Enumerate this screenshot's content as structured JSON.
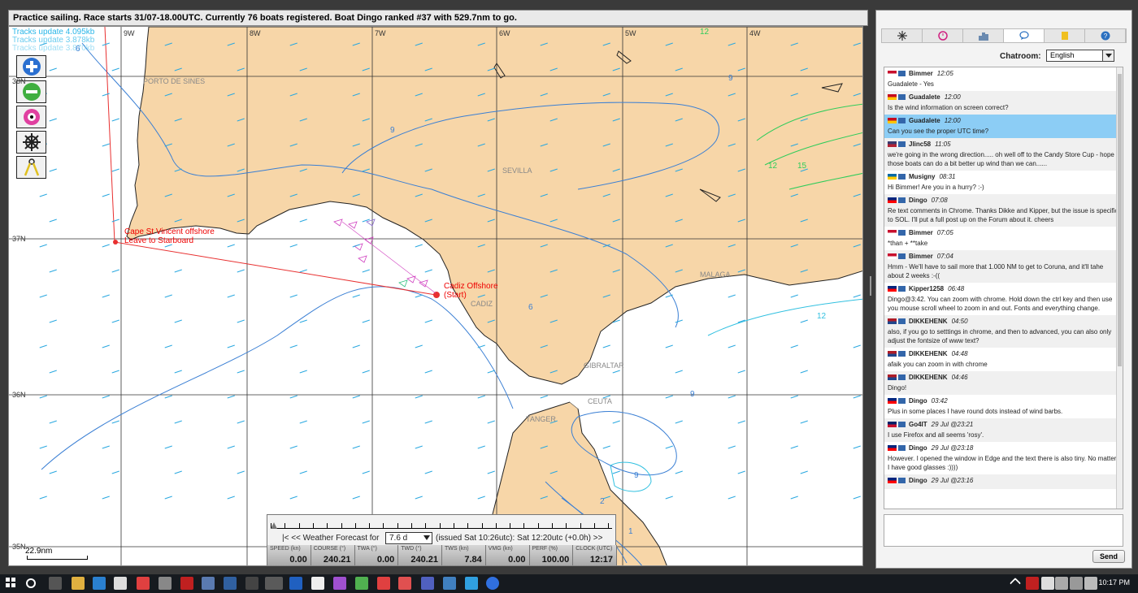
{
  "status_bar": {
    "text": "Practice sailing. Race starts 31/07-18.00UTC. Currently 76 boats registered. Boat Dingo ranked #37 with 529.7nm to go."
  },
  "map": {
    "track_updates": [
      "Tracks update 4.095kb",
      "Tracks update 3.878kb",
      "Tracks update 3.870kb"
    ],
    "lon_labels": [
      "9W",
      "8W",
      "7W",
      "6W",
      "5W",
      "4W"
    ],
    "lat_labels": [
      "38N",
      "37N",
      "36N",
      "35N"
    ],
    "cities": [
      "PORTO DE SINES",
      "SEVILLA",
      "MALAGA",
      "GIBRALTAR",
      "CEUTA",
      "TANGER",
      "CADIZ"
    ],
    "markers": {
      "cape": [
        "Cape St Vincent offshore",
        "Leave to Starboard"
      ],
      "start": [
        "Cadiz Offshore",
        "(Start)"
      ]
    },
    "contour_labels": [
      "6",
      "12",
      "9",
      "9",
      "12",
      "15",
      "6",
      "12",
      "9",
      "9",
      "2",
      "1"
    ],
    "scale_label": "22.9nm",
    "tools": [
      "zoom-in",
      "zoom-out",
      "center-boat",
      "helm",
      "waypoint"
    ]
  },
  "forecast": {
    "prefix": "|<  <<  Weather Forecast for",
    "selected": "7.6 d",
    "issued": "(issued Sat 10:26utc): Sat 12:20utc  (+0.0h)  >>",
    "metrics": [
      {
        "label": "SPEED (kn)",
        "value": "0.00"
      },
      {
        "label": "COURSE (°)",
        "value": "240.21"
      },
      {
        "label": "TWA (°)",
        "value": "0.00"
      },
      {
        "label": "TWD (°)",
        "value": "240.21"
      },
      {
        "label": "TWS (kn)",
        "value": "7.84"
      },
      {
        "label": "VMG (kn)",
        "value": "0.00"
      },
      {
        "label": "PERF (%)",
        "value": "100.00"
      },
      {
        "label": "CLOCK (UTC)",
        "value": "12:17"
      }
    ]
  },
  "sidebar": {
    "tabs": [
      "compass",
      "clock",
      "ranking",
      "chat",
      "notes",
      "help"
    ],
    "active_tab": "chat",
    "chatroom_label": "Chatroom:",
    "chatroom_value": "English",
    "send_label": "Send",
    "messages": [
      {
        "flag": "dk",
        "user": "Bimmer",
        "time": "12:05",
        "text": "Guadalete - Yes"
      },
      {
        "flag": "es",
        "user": "Guadalete",
        "time": "12:00",
        "text": "Is the wind information on screen correct?"
      },
      {
        "flag": "es",
        "user": "Guadalete",
        "time": "12:00",
        "text": "Can you see the proper UTC time?"
      },
      {
        "flag": "us",
        "user": "Jlinc58",
        "time": "11:05",
        "text": "we're going in the wrong direction..... oh well off to the Candy Store Cup - hope those boats can do a bit better up wind than we can......"
      },
      {
        "flag": "se",
        "user": "Musigny",
        "time": "08:31",
        "text": "Hi Bimmer! Are you in a hurry? :-)"
      },
      {
        "flag": "au",
        "user": "Dingo",
        "time": "07:08",
        "text": "Re text comments in Chrome.  Thanks Dikke and Kipper, but the issue is specific to SOL. I'll put a full post up on the Forum about it. cheers"
      },
      {
        "flag": "dk",
        "user": "Bimmer",
        "time": "07:05",
        "text": "*than + **take"
      },
      {
        "flag": "dk",
        "user": "Bimmer",
        "time": "07:04",
        "text": "Hmm - We'll have to sail more that 1.000 NM to get to Coruna, and it'll tahe about 2 weeks :-(("
      },
      {
        "flag": "au",
        "user": "Kipper1258",
        "time": "06:48",
        "text": "Dingo@3:42. You can zoom with chrome. Hold down the ctrl key and then use you mouse scroll wheel to zoom in and out. Fonts and everything change."
      },
      {
        "flag": "nl",
        "user": "DIKKEHENK",
        "time": "04:50",
        "text": "also, if you go to setttings in chrome, and then to advanced, you can also only adjust the fontsize of www text?"
      },
      {
        "flag": "nl",
        "user": "DIKKEHENK",
        "time": "04:48",
        "text": "afaik you can zoom in with chrome"
      },
      {
        "flag": "nl",
        "user": "DIKKEHENK",
        "time": "04:46",
        "text": "Dingo!"
      },
      {
        "flag": "au",
        "user": "Dingo",
        "time": "03:42",
        "text": "Plus in some places I have round dots instead of wind barbs."
      },
      {
        "flag": "gb",
        "user": "Go4IT",
        "time": "29 Jul @23:21",
        "text": "I use Firefox and all seems 'rosy'."
      },
      {
        "flag": "au",
        "user": "Dingo",
        "time": "29 Jul @23:18",
        "text": "However. I opened the window in Edge and the text there is also tiny.  No matter, I have good glasses :))))"
      },
      {
        "flag": "au",
        "user": "Dingo",
        "time": "29 Jul @23:16",
        "text": ""
      }
    ]
  },
  "taskbar": {
    "clock": "10:17 PM",
    "lang": ""
  },
  "colors": {
    "land": "#f7d6a8",
    "sea": "#ffffff",
    "wind_arrow": "#29a8e0",
    "accent": "#8ccdf5",
    "route": "#e83030"
  }
}
